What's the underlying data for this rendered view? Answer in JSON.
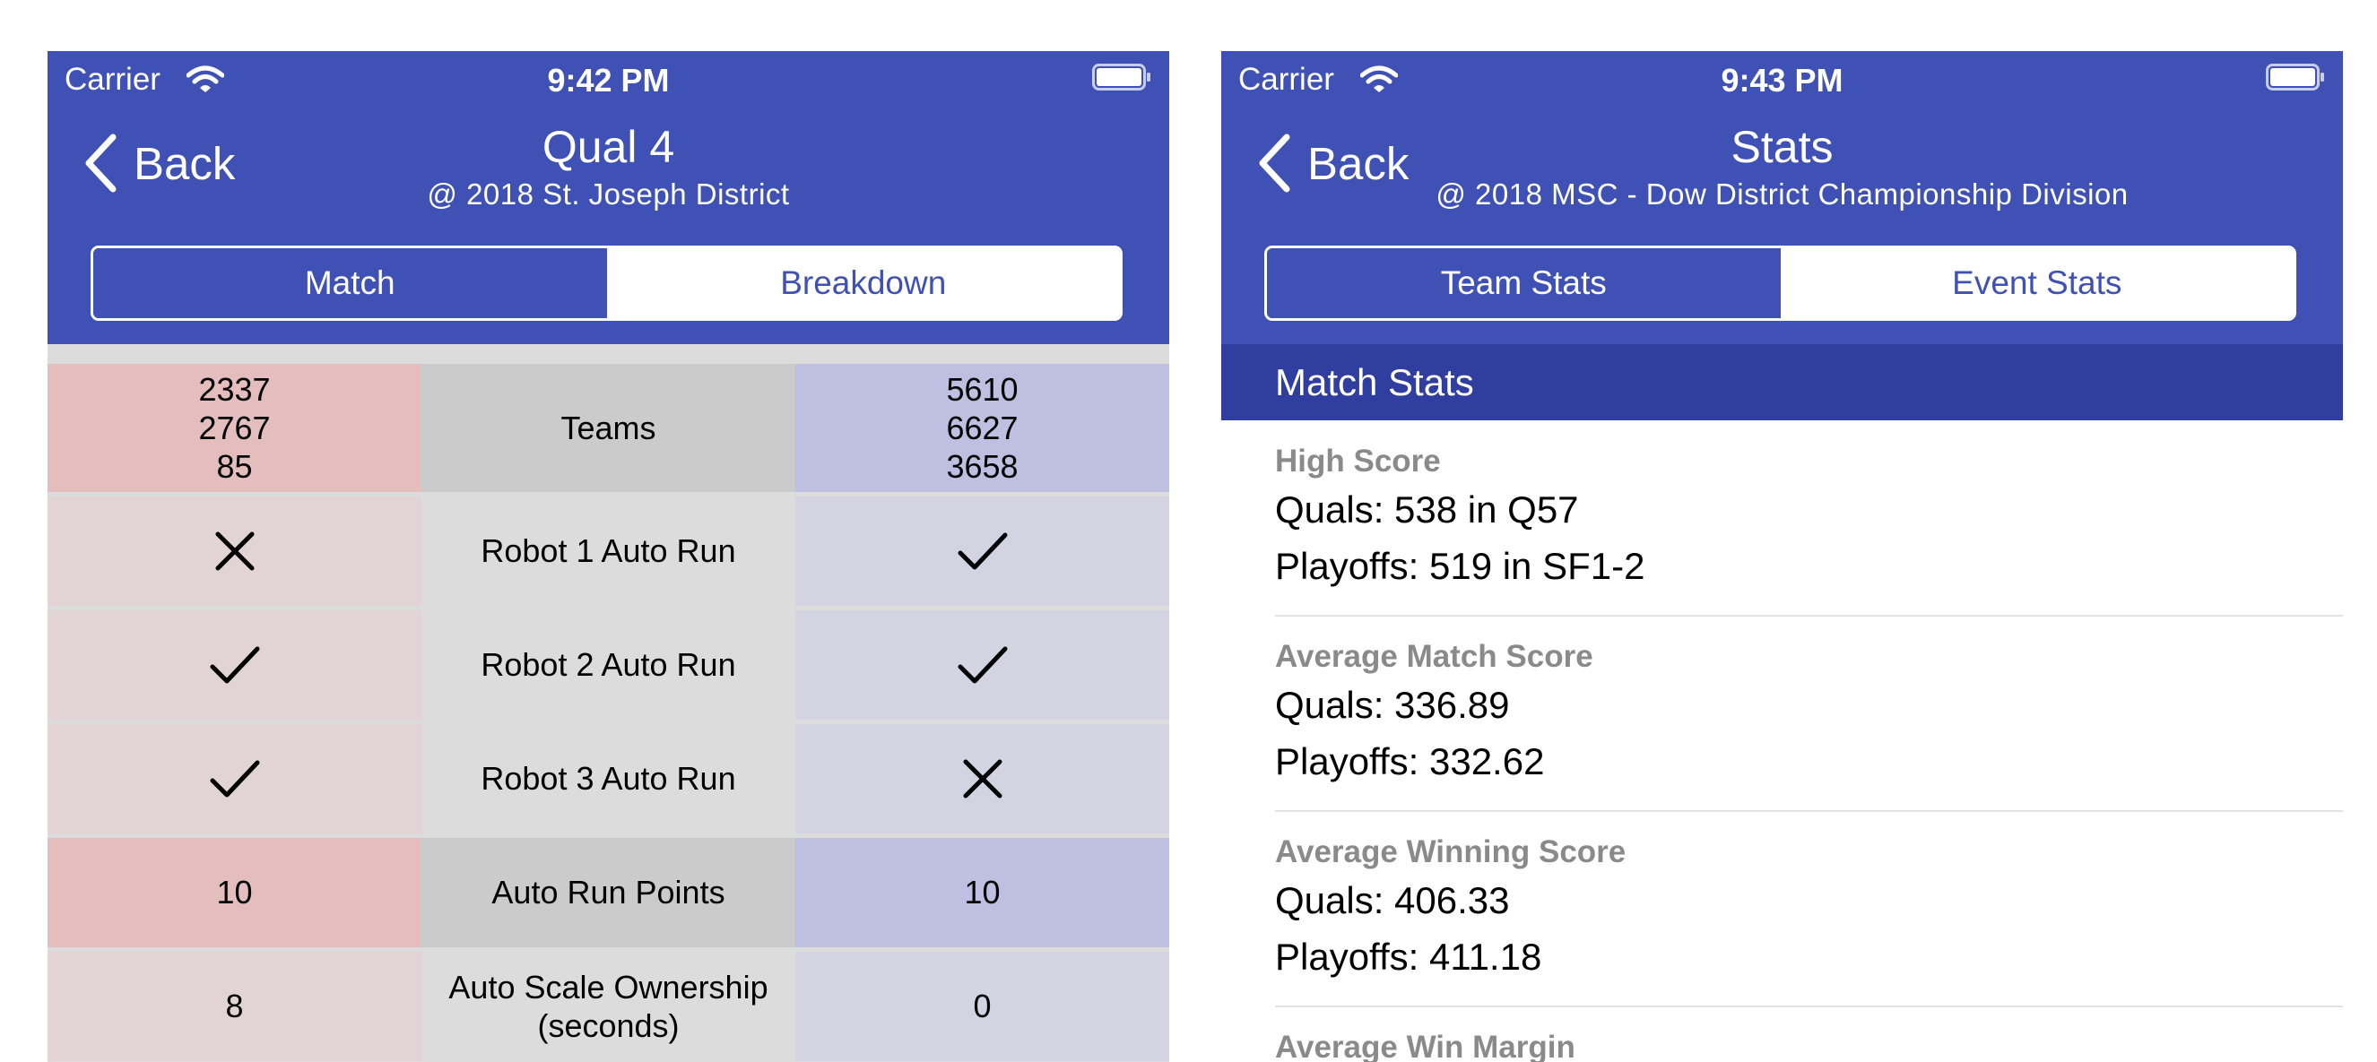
{
  "left_screen": {
    "status": {
      "carrier": "Carrier",
      "time": "9:42 PM"
    },
    "nav": {
      "back_label": "Back",
      "title": "Qual 4",
      "subtitle": "@ 2018 St. Joseph District"
    },
    "segments": [
      "Match",
      "Breakdown"
    ],
    "selected_segment": "Match",
    "breakdown": {
      "teams": {
        "label": "Teams",
        "red": [
          "2337",
          "2767",
          "85"
        ],
        "blue": [
          "5610",
          "6627",
          "3658"
        ]
      },
      "rows": [
        {
          "label": "Robot 1 Auto Run",
          "red_icon": "cross-icon",
          "blue_icon": "checkmark-icon"
        },
        {
          "label": "Robot 2 Auto Run",
          "red_icon": "checkmark-icon",
          "blue_icon": "checkmark-icon"
        },
        {
          "label": "Robot 3 Auto Run",
          "red_icon": "checkmark-icon",
          "blue_icon": "cross-icon"
        },
        {
          "label": "Auto Run Points",
          "red": "10",
          "blue": "10"
        },
        {
          "label": "Auto Scale Ownership (seconds)",
          "red": "8",
          "blue": "0"
        }
      ]
    }
  },
  "right_screen": {
    "status": {
      "carrier": "Carrier",
      "time": "9:43 PM"
    },
    "nav": {
      "back_label": "Back",
      "title": "Stats",
      "subtitle": "@ 2018 MSC - Dow District Championship Division"
    },
    "segments": [
      "Team Stats",
      "Event Stats"
    ],
    "selected_segment": "Team Stats",
    "section_header": "Match Stats",
    "stats": [
      {
        "label": "High Score",
        "lines": [
          "Quals: 538 in Q57",
          "Playoffs: 519 in SF1-2"
        ]
      },
      {
        "label": "Average Match Score",
        "lines": [
          "Quals: 336.89",
          "Playoffs: 332.62"
        ]
      },
      {
        "label": "Average Winning Score",
        "lines": [
          "Quals: 406.33",
          "Playoffs: 411.18"
        ]
      },
      {
        "label": "Average Win Margin",
        "lines": []
      }
    ]
  },
  "colors": {
    "primary": "#3f51b5",
    "primary_dark": "#303f9f",
    "red_alliance": "#e4bdbd",
    "blue_alliance": "#bfbfe2"
  }
}
